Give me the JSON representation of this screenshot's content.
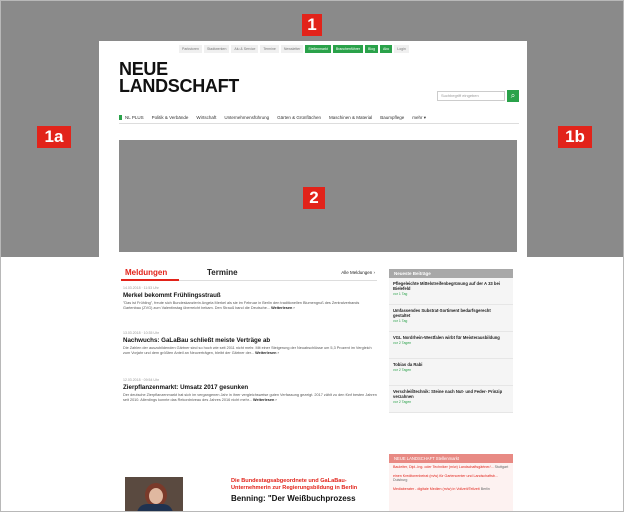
{
  "markers": {
    "m1": "1",
    "m1a": "1a",
    "m1b": "1b",
    "m2": "2"
  },
  "topnav": [
    "Parkstoren",
    "Stadtwerken",
    "Alu & Service",
    "Termine",
    "Newsletter",
    "Stellenmarkt",
    "Branchenführer",
    "Blog",
    "Abo",
    "Login"
  ],
  "logo": {
    "line1": "NEUE",
    "line2": "LANDSCHAFT"
  },
  "search": {
    "placeholder": "Suchbegriff eingeben"
  },
  "mainnav": [
    "NL PLUS",
    "Politik & Verbände",
    "Wirtschaft",
    "Unternehmensführung",
    "Gärten & Grünflächen",
    "Maschinen & Material",
    "Baumpflege",
    "mehr ▾"
  ],
  "tabs": {
    "meldungen": "Meldungen",
    "termine": "Termine",
    "alle": "Alle Meldungen ›"
  },
  "news": [
    {
      "date": "14.03.2018 · 11:53 Uhr",
      "head": "Merkel bekommt Frühlingsstrauß",
      "body": "\"Das ist Frühling\", freute sich Bundeskanzlerin Angela Merkel als sie im Februar in Berlin den traditionellen Blumengruß des Zentralverbands Gartenbau (ZVG) zum Valentinstag überreicht bekam. Den Strauß band die Deutsche...",
      "more": "Weiterlesen ›"
    },
    {
      "date": "13.03.2018 · 10:35 Uhr",
      "head": "Nachwuchs: GaLaBau schließt meiste Verträge ab",
      "body": "Die Zahlen der auszubildenden Gärtner sind so hoch wie seit 2011 nicht mehr. Mit einer Steigerung der Neuabschlüsse um 5,3 Prozent im Vergleich zum Vorjahr und dem größten Anteil an Neuverträgen, bleibt der Gärtner der...",
      "more": "Weiterlesen ›"
    },
    {
      "date": "12.03.2018 · 09:54 Uhr",
      "head": "Zierpflanzenmarkt: Umsatz 2017 gesunken",
      "body": "Der deutsche Zierpflanzenmarkt hat sich im vergangenen Jahr in ihrer vergleichsweise guten Verfassung gezeigt. 2017 zählt zu den fünf besten Jahren seit 2010. Allerdings konnte das Rekordniveau des Jahres 2016 nicht mehr...",
      "more": "Weiterlesen ›"
    }
  ],
  "side": {
    "header": "Neueste Beiträge",
    "items": [
      {
        "title": "Pflegeleichte Mittelstreifenbegrünung auf der A 33 bei Bielefeld",
        "meta": "vor 1 Tag"
      },
      {
        "title": "Umfassendes Substrat-Sortiment bedarfsgerecht gestaltet",
        "meta": "vor 1 Tag"
      },
      {
        "title": "VGL Nordrhein-Westfalen wirbt für Meisterausbildung",
        "meta": "vor 2 Tagen"
      },
      {
        "title": "Tobias da Rabi",
        "meta": "vor 2 Tagen"
      },
      {
        "title": "Verschleißtechnik: Steine nach Nut- und Feder- Prinzip verzahnen",
        "meta": "vor 2 Tagen"
      }
    ]
  },
  "side2": {
    "header": "NEUE LANDSCHAFT Stellenmarkt",
    "rows": [
      {
        "title": "Bauleiter, Dipl.-Ing. oder Techniker (m/w) Landschaftsgärtner/...",
        "place": "Stuttgart"
      },
      {
        "title": "einen Kreditorenbeirat (m/w) für Gartencenter und Landschaftsb...",
        "place": "Duisburg"
      },
      {
        "title": "Mediaberater - digitale Medien (m/w) in Vollzeit/Teilzeit",
        "place": "Berlin"
      }
    ]
  },
  "feature": {
    "teaser": "Die Bundestagsabgeordnete und GaLaBau-Unternehmerin zur Regierungsbildung in Berlin",
    "headline": "Benning: \"Der Weißbuchprozess"
  }
}
